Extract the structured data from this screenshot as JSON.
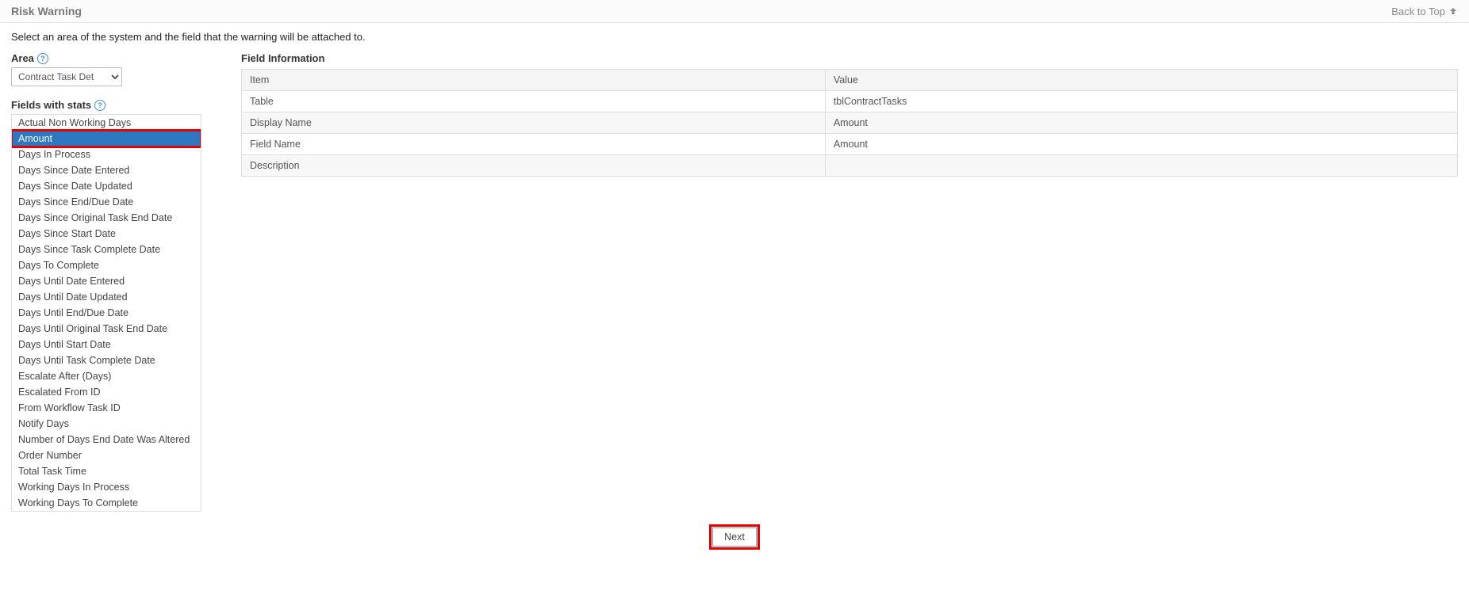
{
  "header": {
    "title": "Risk Warning",
    "back_to_top": "Back to Top"
  },
  "instruction": "Select an area of the system and the field that the warning will be attached to.",
  "area": {
    "label": "Area",
    "selected": "Contract Task Det"
  },
  "fields_section": {
    "label": "Fields with stats",
    "items": [
      {
        "label": "Actual Non Working Days",
        "selected": false
      },
      {
        "label": "Amount",
        "selected": true
      },
      {
        "label": "Days In Process",
        "selected": false
      },
      {
        "label": "Days Since Date Entered",
        "selected": false
      },
      {
        "label": "Days Since Date Updated",
        "selected": false
      },
      {
        "label": "Days Since End/Due Date",
        "selected": false
      },
      {
        "label": "Days Since Original Task End Date",
        "selected": false
      },
      {
        "label": "Days Since Start Date",
        "selected": false
      },
      {
        "label": "Days Since Task Complete Date",
        "selected": false
      },
      {
        "label": "Days To Complete",
        "selected": false
      },
      {
        "label": "Days Until Date Entered",
        "selected": false
      },
      {
        "label": "Days Until Date Updated",
        "selected": false
      },
      {
        "label": "Days Until End/Due Date",
        "selected": false
      },
      {
        "label": "Days Until Original Task End Date",
        "selected": false
      },
      {
        "label": "Days Until Start Date",
        "selected": false
      },
      {
        "label": "Days Until Task Complete Date",
        "selected": false
      },
      {
        "label": "Escalate After (Days)",
        "selected": false
      },
      {
        "label": "Escalated From ID",
        "selected": false
      },
      {
        "label": "From Workflow Task ID",
        "selected": false
      },
      {
        "label": "Notify Days",
        "selected": false
      },
      {
        "label": "Number of Days End Date Was Altered",
        "selected": false
      },
      {
        "label": "Order Number",
        "selected": false
      },
      {
        "label": "Total Task Time",
        "selected": false
      },
      {
        "label": "Working Days In Process",
        "selected": false
      },
      {
        "label": "Working Days To Complete",
        "selected": false
      }
    ]
  },
  "field_information": {
    "title": "Field Information",
    "headers": {
      "item": "Item",
      "value": "Value"
    },
    "rows": [
      {
        "item": "Table",
        "value": "tblContractTasks"
      },
      {
        "item": "Display Name",
        "value": "Amount"
      },
      {
        "item": "Field Name",
        "value": "Amount"
      },
      {
        "item": "Description",
        "value": ""
      }
    ]
  },
  "footer": {
    "next": "Next"
  }
}
